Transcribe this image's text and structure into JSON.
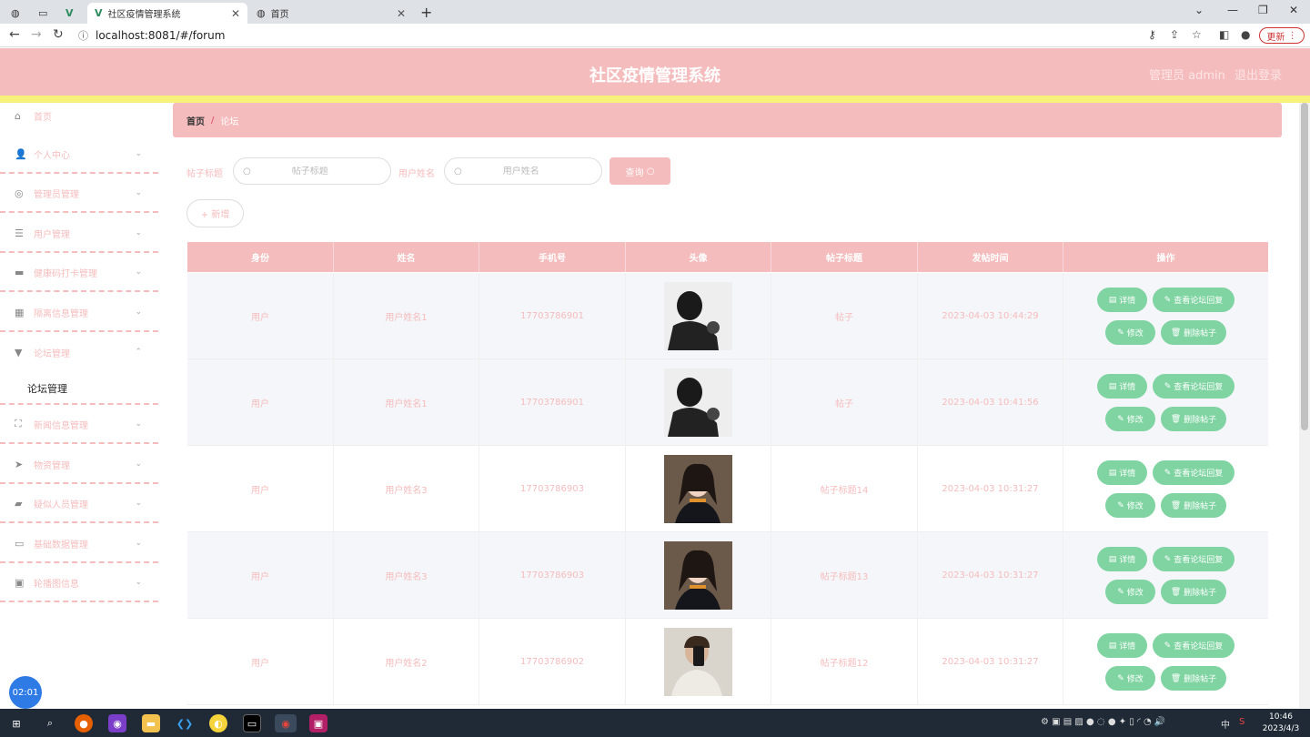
{
  "browser": {
    "tabs": [
      {
        "label": "",
        "icon": "globe-icon"
      },
      {
        "label": "",
        "icon": "page-icon"
      },
      {
        "label": "",
        "icon": "vue-icon"
      },
      {
        "label": "社区疫情管理系统",
        "icon": "vue-icon",
        "active": true
      },
      {
        "label": "首页",
        "icon": "globe-icon"
      }
    ],
    "url": "localhost:8081/#/forum",
    "update_label": "更新"
  },
  "header": {
    "title": "社区疫情管理系统",
    "user": "管理员 admin",
    "logout": "退出登录"
  },
  "sidebar": {
    "items": [
      {
        "label": "首页",
        "icon": "home-icon",
        "chevron": ""
      },
      {
        "label": "个人中心",
        "icon": "person-icon",
        "chevron": "⌄"
      },
      {
        "label": "管理员管理",
        "icon": "admin-icon",
        "chevron": "⌄"
      },
      {
        "label": "用户管理",
        "icon": "sliders-icon",
        "chevron": "⌄"
      },
      {
        "label": "健康码打卡管理",
        "icon": "briefcase-icon",
        "chevron": "⌄"
      },
      {
        "label": "隔离信息管理",
        "icon": "grid-icon",
        "chevron": "⌄"
      },
      {
        "label": "论坛管理",
        "icon": "forum-icon",
        "chevron": "⌃"
      },
      {
        "label": "新闻信息管理",
        "icon": "expand-icon",
        "chevron": "⌄"
      },
      {
        "label": "物资管理",
        "icon": "send-icon",
        "chevron": "⌄"
      },
      {
        "label": "疑似人员管理",
        "icon": "ticket-icon",
        "chevron": "⌄"
      },
      {
        "label": "基础数据管理",
        "icon": "monitor-icon",
        "chevron": "⌄"
      },
      {
        "label": "轮播图信息",
        "icon": "clipboard-icon",
        "chevron": "⌄"
      }
    ],
    "sub_item": "论坛管理"
  },
  "breadcrumb": {
    "home": "首页",
    "separator": "/",
    "current": "论坛"
  },
  "filters": {
    "title_label": "帖子标题",
    "title_placeholder": "帖子标题",
    "user_label": "用户姓名",
    "user_placeholder": "用户姓名",
    "query_label": "查询",
    "add_label": "+ 新增"
  },
  "table": {
    "headers": [
      "身份",
      "姓名",
      "手机号",
      "头像",
      "帖子标题",
      "发帖时间",
      "操作"
    ],
    "rows": [
      {
        "role": "用户",
        "name": "用户姓名1",
        "phone": "17703786901",
        "avatar": "man-silhouette",
        "title": "帖子",
        "time": "2023-04-03 10:44:29"
      },
      {
        "role": "用户",
        "name": "用户姓名1",
        "phone": "17703786901",
        "avatar": "man-silhouette",
        "title": "帖子",
        "time": "2023-04-03 10:41:56"
      },
      {
        "role": "用户",
        "name": "用户姓名3",
        "phone": "17703786903",
        "avatar": "woman-portrait",
        "title": "帖子标题14",
        "time": "2023-04-03 10:31:27"
      },
      {
        "role": "用户",
        "name": "用户姓名3",
        "phone": "17703786903",
        "avatar": "woman-portrait",
        "title": "帖子标题13",
        "time": "2023-04-03 10:31:27"
      },
      {
        "role": "用户",
        "name": "用户姓名2",
        "phone": "17703786902",
        "avatar": "man-selfie",
        "title": "帖子标题12",
        "time": "2023-04-03 10:31:27"
      }
    ],
    "actions": {
      "detail": "详情",
      "view_replies": "查看论坛回复",
      "edit": "修改",
      "delete": "删除帖子"
    }
  },
  "timer": "02:01",
  "taskbar": {
    "time": "10:46",
    "date": "2023/4/3",
    "ime": "中"
  },
  "colors": {
    "primary": "#f5bcbd",
    "accent_yellow": "#f5f17a",
    "action_green": "#7fd4a2"
  }
}
